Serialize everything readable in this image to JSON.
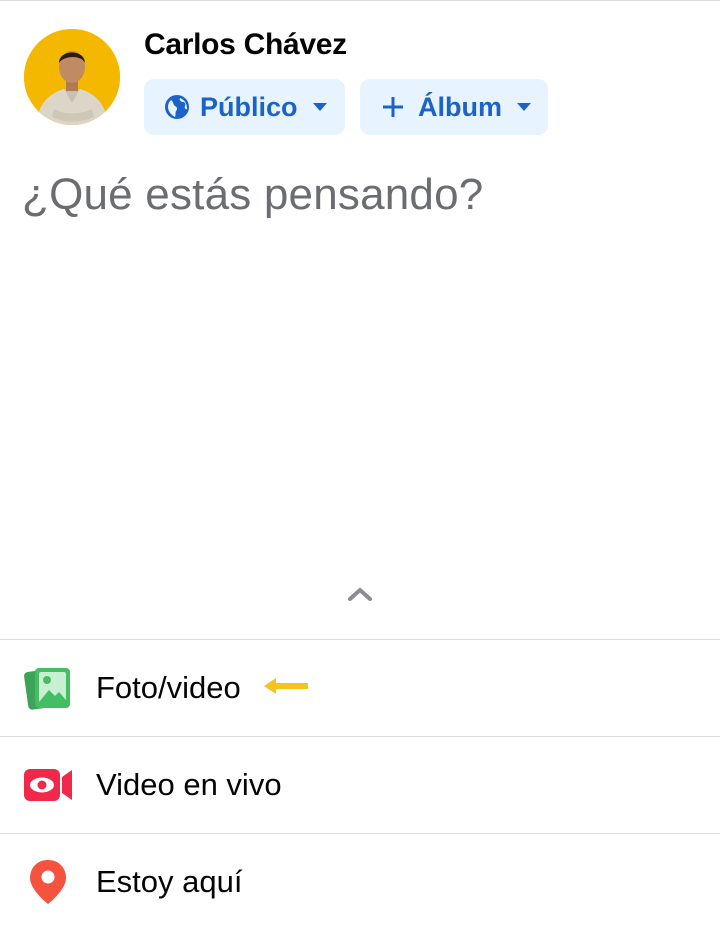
{
  "user": {
    "name": "Carlos Chávez"
  },
  "audience_chip": {
    "label": "Público",
    "icon": "globe-icon"
  },
  "album_chip": {
    "label": "Álbum",
    "icon": "plus-icon"
  },
  "composer": {
    "placeholder": "¿Qué estás pensando?",
    "value": ""
  },
  "expand_toggle": {
    "icon": "chevron-up-icon"
  },
  "options": [
    {
      "label": "Foto/video",
      "icon": "photo-video-icon"
    },
    {
      "label": "Video en vivo",
      "icon": "live-video-icon"
    },
    {
      "label": "Estoy aquí",
      "icon": "location-pin-icon"
    }
  ],
  "annotation": {
    "icon": "arrow-left-icon",
    "color": "#f7c21a"
  },
  "colors": {
    "chip_background": "#e7f3ff",
    "chip_text": "#1b63c7",
    "photo_green": "#45bd62",
    "live_red": "#f02849",
    "location_red": "#f5533d",
    "avatar_background": "#f5b800"
  }
}
